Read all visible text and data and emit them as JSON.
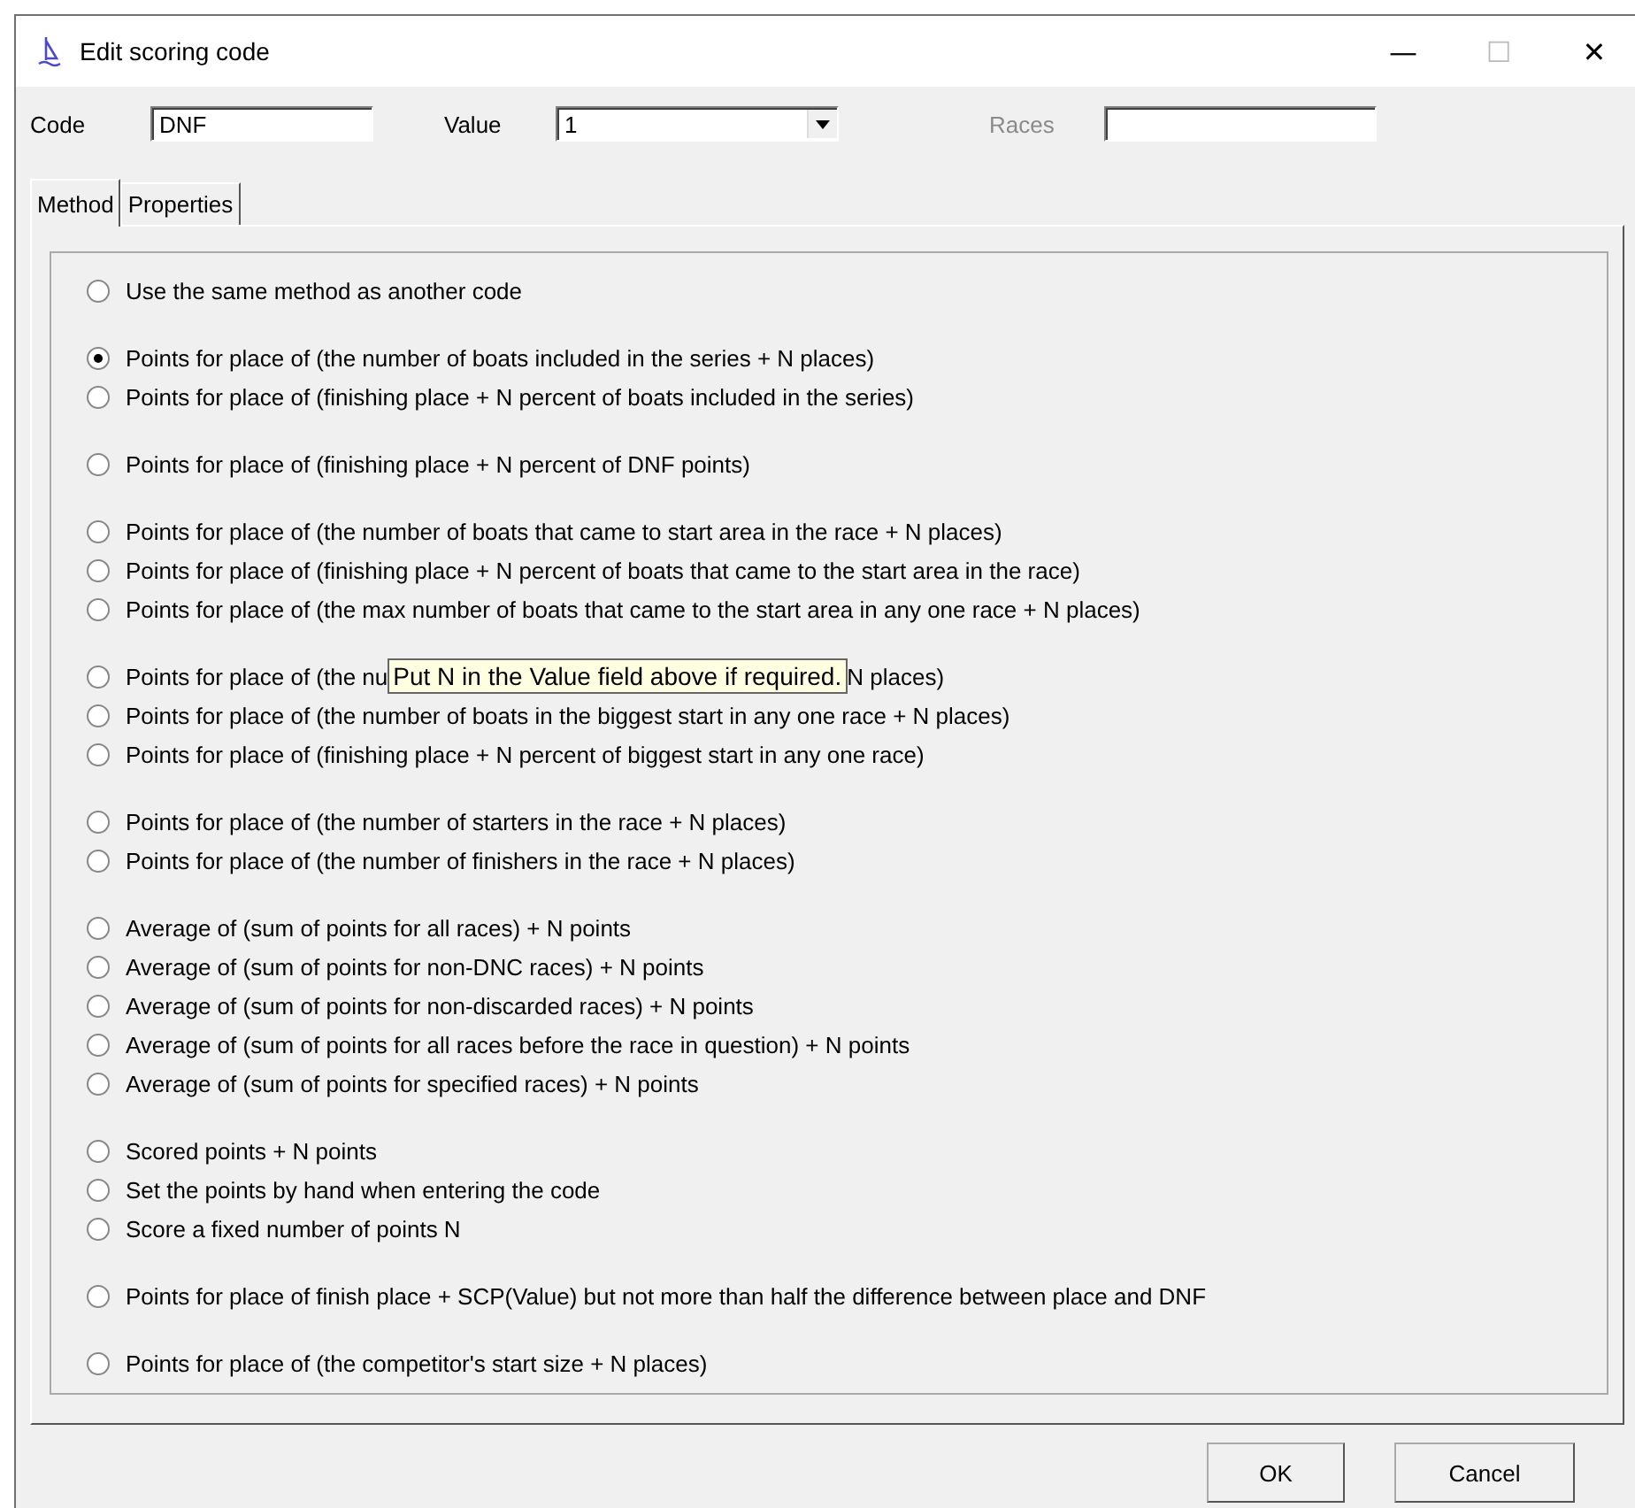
{
  "window": {
    "title": "Edit scoring code",
    "controls": [
      "—",
      "☐",
      "✕"
    ]
  },
  "fields": [
    {
      "kind": "text",
      "label": "Code",
      "value": "DNF",
      "disabled": false
    },
    {
      "kind": "combo",
      "label": "Value",
      "value": "1",
      "disabled": false
    },
    {
      "kind": "text",
      "label": "Races",
      "disabled": true
    }
  ],
  "tabs": [
    {
      "label": "Method",
      "selected": true
    },
    {
      "label": "Properties",
      "selected": false
    }
  ],
  "method_groups": [
    [
      {
        "label": "Use the same method as another code",
        "selected": false
      }
    ],
    [
      {
        "label": "Points for place of (the number of boats included in the series + N places)",
        "selected": true
      },
      {
        "label": "Points for place of (finishing place + N percent of boats included in the series)",
        "selected": false
      }
    ],
    [
      {
        "label": "Points for place of (finishing place + N percent of DNF points)",
        "selected": false
      }
    ],
    [
      {
        "label": "Points for place of (the number of boats that came to start area in the race + N places)",
        "selected": false
      },
      {
        "label": "Points for place of (finishing place + N percent of boats that came to the start area in the race)",
        "selected": false
      },
      {
        "label": "Points for place of (the max number of boats that came to the start area in any one race + N places)",
        "selected": false
      }
    ],
    [
      {
        "label_start": "Points for place of (the nu",
        "tooltip": "Put N in the Value field above if required.",
        "label_end": "N places)",
        "selected": false
      },
      {
        "label": "Points for place of (the number of boats in the biggest start in any one race + N places)",
        "selected": false
      },
      {
        "label": "Points for place of (finishing place + N percent of biggest start in any one race)",
        "selected": false
      }
    ],
    [
      {
        "label": "Points for place of (the number of starters in the race + N places)",
        "selected": false
      },
      {
        "label": "Points for place of (the number of finishers in the race + N places)",
        "selected": false
      }
    ],
    [
      {
        "label": "Average of (sum of points for all races) + N points",
        "selected": false
      },
      {
        "label": "Average of (sum of points for non-DNC races) + N points",
        "selected": false
      },
      {
        "label": "Average of (sum of points for non-discarded races) + N points",
        "selected": false
      },
      {
        "label": "Average of (sum of points for all races before the race in question) + N points",
        "selected": false
      },
      {
        "label": "Average of (sum of points for specified races) + N points",
        "selected": false
      }
    ],
    [
      {
        "label": "Scored points + N points",
        "selected": false
      },
      {
        "label": "Set the points by hand when entering the code",
        "selected": false
      },
      {
        "label": "Score a fixed number of points N",
        "selected": false
      }
    ],
    [
      {
        "label": "Points for place of finish place + SCP(Value) but not more than half the difference between place and DNF",
        "selected": false
      }
    ],
    [
      {
        "label": "Points for place of (the competitor's start size + N places)",
        "selected": false
      }
    ]
  ],
  "buttons": [
    "OK",
    "Cancel"
  ]
}
